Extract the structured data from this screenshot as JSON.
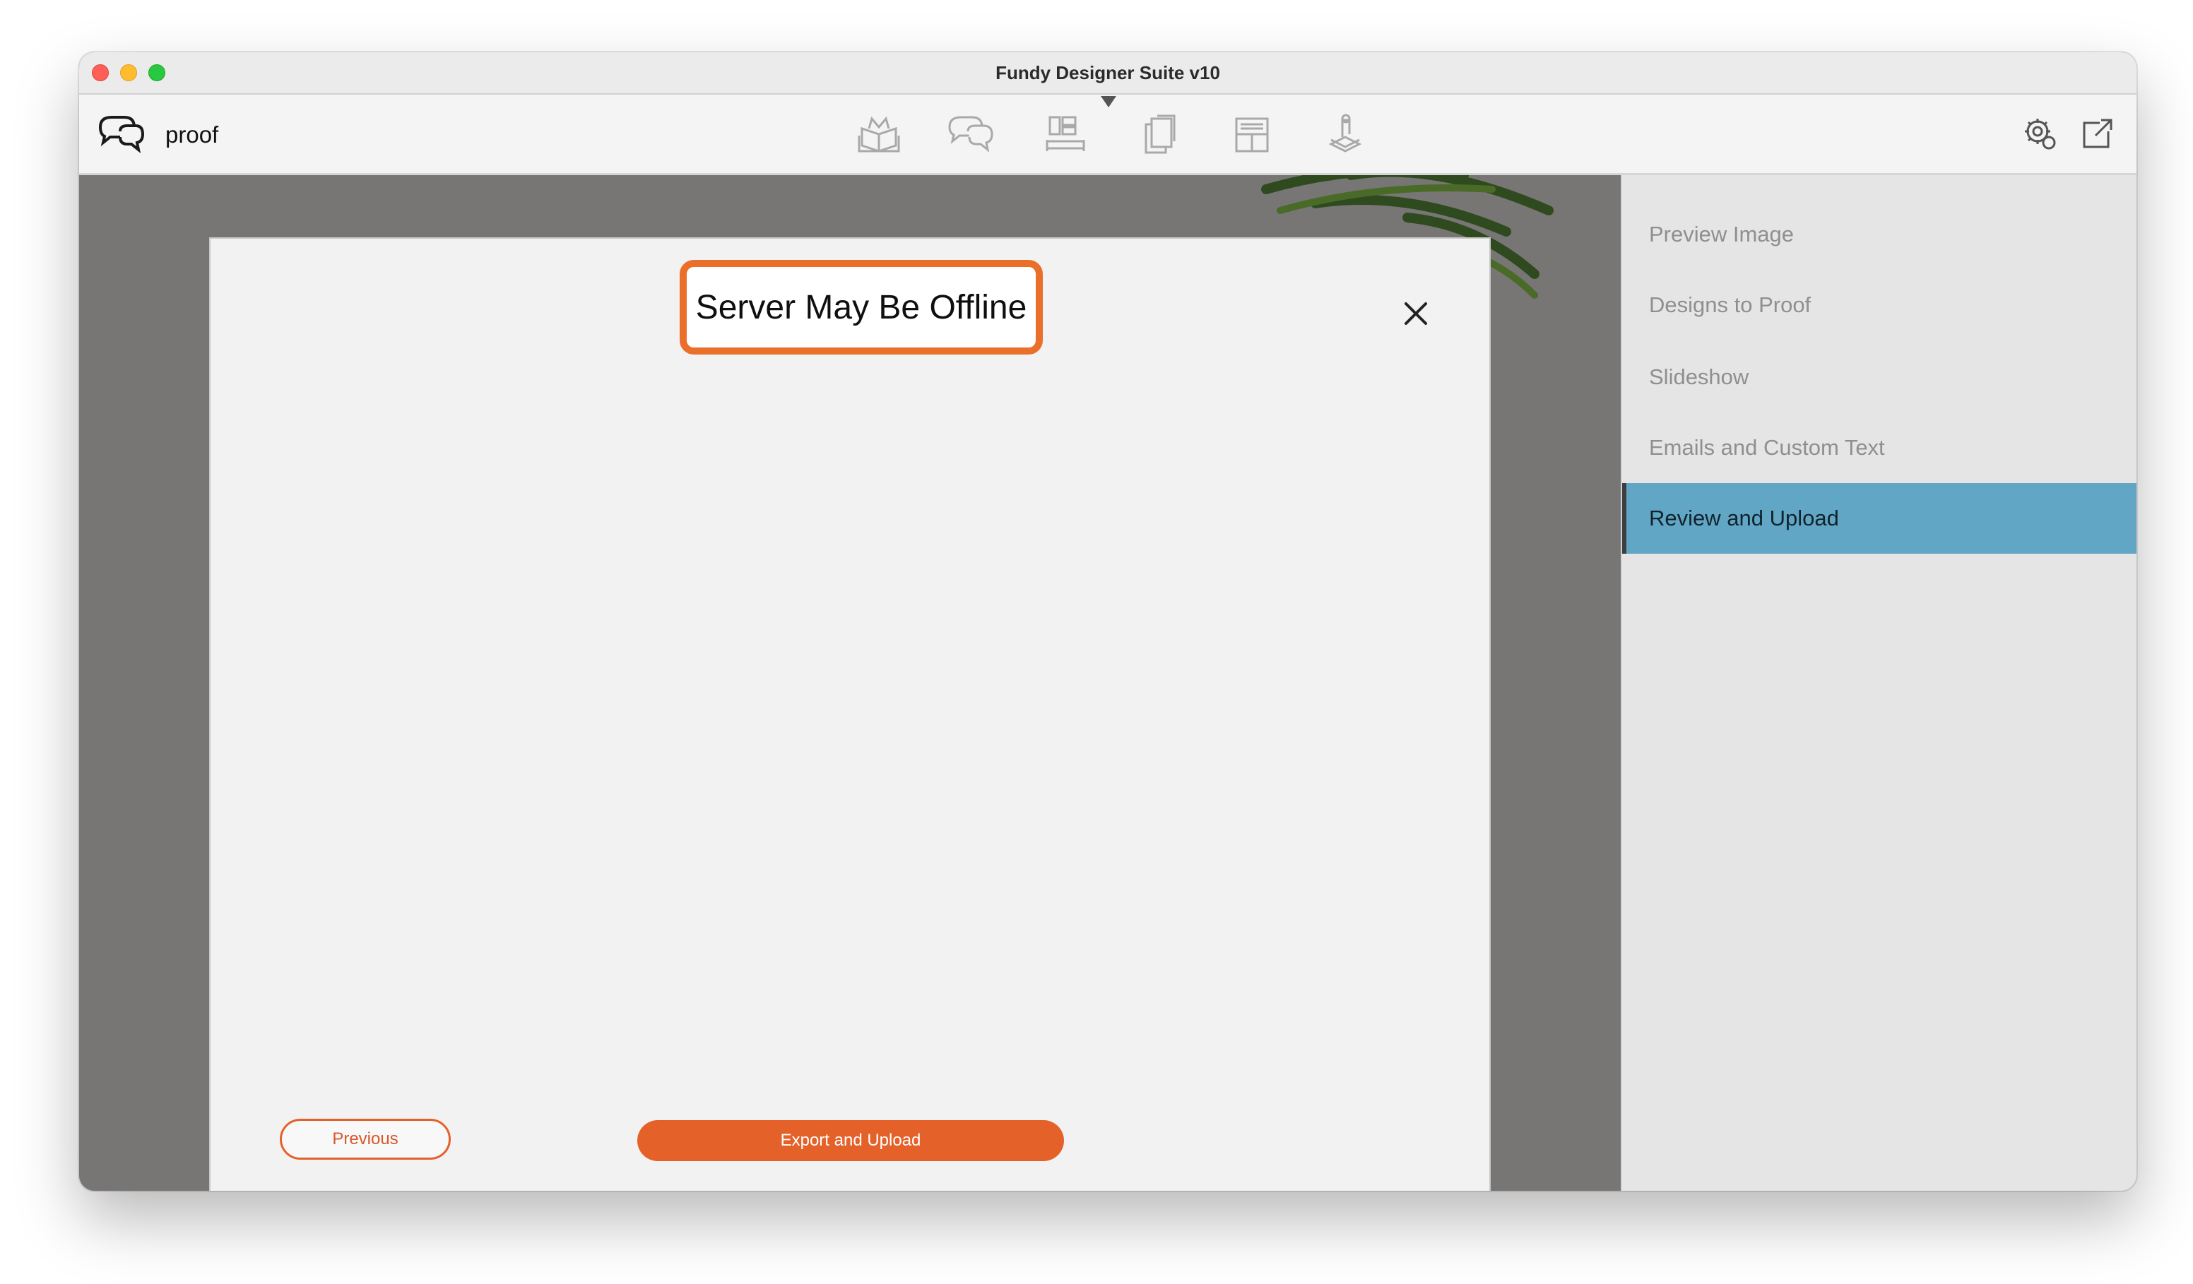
{
  "window": {
    "title": "Fundy Designer Suite v10"
  },
  "toolbar": {
    "app_name": "proof",
    "modes": [
      {
        "icon": "album-design-icon"
      },
      {
        "icon": "proof-icon"
      },
      {
        "icon": "wall-gallery-icon"
      },
      {
        "icon": "image-sales-icon"
      },
      {
        "icon": "cards-icon"
      },
      {
        "icon": "print-stack-icon"
      }
    ],
    "right_icons": [
      "settings-gear-icon",
      "external-window-icon"
    ]
  },
  "dialog": {
    "title": "Server May Be Offline",
    "previous_label": "Previous",
    "export_label": "Export and Upload"
  },
  "sidebar": {
    "items": [
      {
        "label": "Preview Image",
        "active": false
      },
      {
        "label": "Designs to Proof",
        "active": false
      },
      {
        "label": "Slideshow",
        "active": false
      },
      {
        "label": "Emails and Custom Text",
        "active": false
      },
      {
        "label": "Review and Upload",
        "active": true
      }
    ]
  },
  "colors": {
    "accent_orange": "#e4622a",
    "highlight_orange": "#ea6f2b",
    "active_blue": "#62a6c5"
  }
}
